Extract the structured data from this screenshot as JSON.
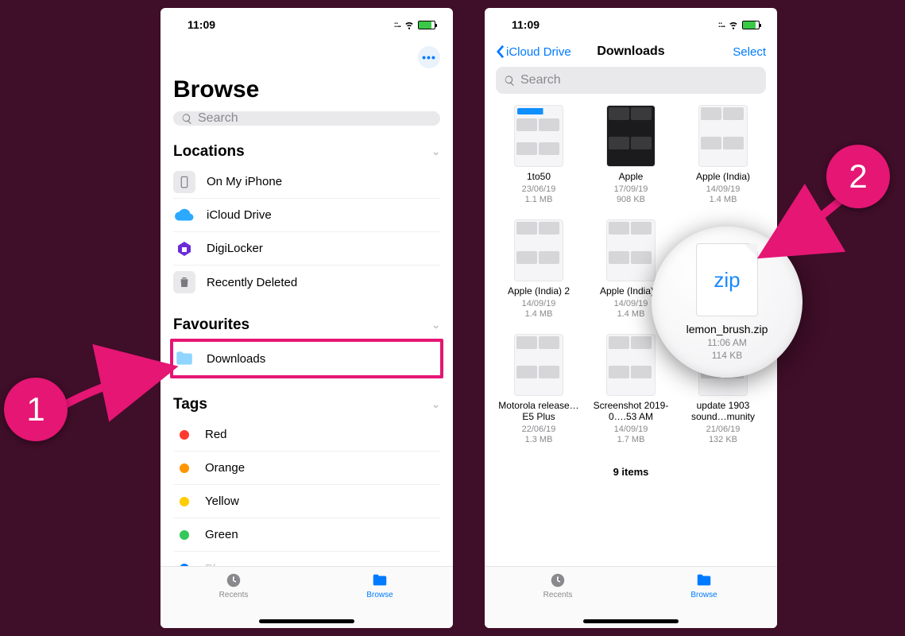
{
  "status": {
    "time": "11:09"
  },
  "left": {
    "title": "Browse",
    "search_placeholder": "Search",
    "sections": {
      "locations": "Locations",
      "favourites": "Favourites",
      "tags": "Tags"
    },
    "locations": [
      {
        "label": "On My iPhone"
      },
      {
        "label": "iCloud Drive"
      },
      {
        "label": "DigiLocker"
      },
      {
        "label": "Recently Deleted"
      }
    ],
    "favourites": [
      {
        "label": "Downloads"
      }
    ],
    "tags": [
      {
        "label": "Red",
        "color": "#ff3b30"
      },
      {
        "label": "Orange",
        "color": "#ff9500"
      },
      {
        "label": "Yellow",
        "color": "#ffcc00"
      },
      {
        "label": "Green",
        "color": "#34c759"
      },
      {
        "label": "Blue",
        "color": "#007aff"
      }
    ],
    "tabs": {
      "recents": "Recents",
      "browse": "Browse"
    }
  },
  "right": {
    "back": "iCloud Drive",
    "title": "Downloads",
    "select": "Select",
    "search_placeholder": "Search",
    "items": [
      {
        "name": "1to50",
        "date": "23/06/19",
        "size": "1.1 MB"
      },
      {
        "name": "Apple",
        "date": "17/09/19",
        "size": "908 KB"
      },
      {
        "name": "Apple (India)",
        "date": "14/09/19",
        "size": "1.4 MB"
      },
      {
        "name": "Apple (India) 2",
        "date": "14/09/19",
        "size": "1.4 MB"
      },
      {
        "name": "Apple (India) 3",
        "date": "14/09/19",
        "size": "1.4 MB"
      },
      {
        "name": "lemon_brush",
        "date": "11:06 AM",
        "size": "114 KB"
      },
      {
        "name": "Motorola release…E5 Plus",
        "date": "22/06/19",
        "size": "1.3 MB"
      },
      {
        "name": "Screenshot 2019-0….53 AM",
        "date": "14/09/19",
        "size": "1.7 MB"
      },
      {
        "name": "update 1903 sound…munity",
        "date": "21/06/19",
        "size": "132 KB"
      }
    ],
    "count": "9 items",
    "tabs": {
      "recents": "Recents",
      "browse": "Browse"
    }
  },
  "magnify": {
    "ext": "zip",
    "name": "lemon_brush.zip",
    "time": "11:06 AM",
    "size": "114 KB"
  },
  "annotations": {
    "one": "1",
    "two": "2"
  }
}
